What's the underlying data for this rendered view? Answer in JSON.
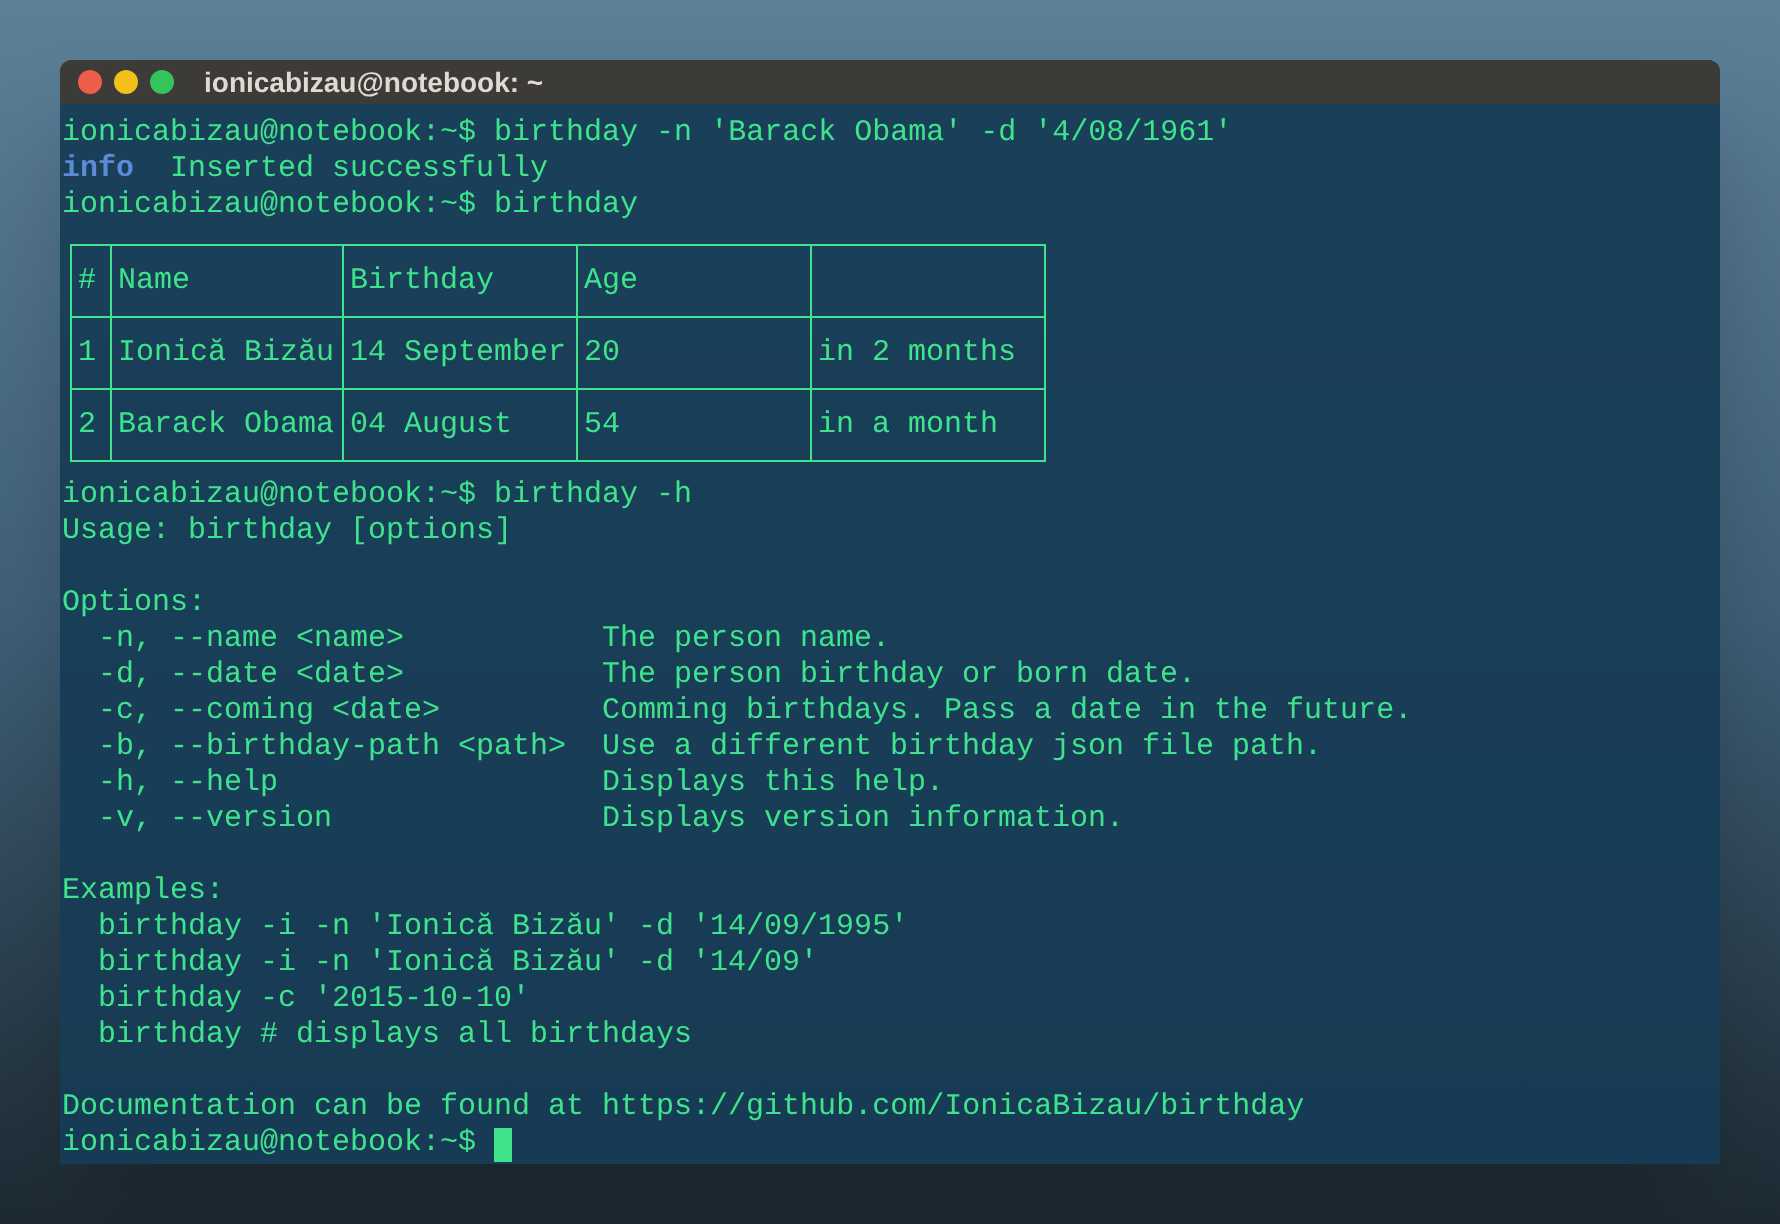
{
  "window": {
    "title": "ionicabizau@notebook: ~"
  },
  "lines": [
    {
      "kind": "command",
      "prompt": "ionicabizau@notebook:~$",
      "command": "birthday -n 'Barack Obama' -d '4/08/1961'"
    },
    {
      "kind": "info",
      "tag": "info",
      "message": "Inserted successfully"
    },
    {
      "kind": "command",
      "prompt": "ionicabizau@notebook:~$",
      "command": "birthday"
    },
    {
      "kind": "table",
      "columns": [
        "#",
        "Name",
        "Birthday",
        "Age"
      ],
      "rows": [
        [
          "1",
          "Ionică Bizău",
          "14 September",
          "20",
          "in 2 months"
        ],
        [
          "2",
          "Barack Obama",
          "04 August",
          "54",
          "in a month"
        ]
      ]
    },
    {
      "kind": "command",
      "prompt": "ionicabizau@notebook:~$",
      "command": "birthday -h"
    },
    {
      "kind": "text",
      "text": "Usage: birthday [options]"
    },
    {
      "kind": "blank"
    },
    {
      "kind": "text",
      "text": "Options:"
    },
    {
      "kind": "option",
      "flag": "-n, --name <name>",
      "description": "The person name."
    },
    {
      "kind": "option",
      "flag": "-d, --date <date>",
      "description": "The person birthday or born date."
    },
    {
      "kind": "option",
      "flag": "-c, --coming <date>",
      "description": "Comming birthdays. Pass a date in the future."
    },
    {
      "kind": "option",
      "flag": "-b, --birthday-path <path>",
      "description": "Use a different birthday json file path."
    },
    {
      "kind": "option",
      "flag": "-h, --help",
      "description": "Displays this help."
    },
    {
      "kind": "option",
      "flag": "-v, --version",
      "description": "Displays version information."
    },
    {
      "kind": "blank"
    },
    {
      "kind": "text",
      "text": "Examples:"
    },
    {
      "kind": "example",
      "text": "birthday -i -n 'Ionică Bizău' -d '14/09/1995'"
    },
    {
      "kind": "example",
      "text": "birthday -i -n 'Ionică Bizău' -d '14/09'"
    },
    {
      "kind": "example",
      "text": "birthday -c '2015-10-10'"
    },
    {
      "kind": "example",
      "text": "birthday # displays all birthdays"
    },
    {
      "kind": "blank"
    },
    {
      "kind": "text",
      "text": "Documentation can be found at https://github.com/IonicaBizau/birthday"
    },
    {
      "kind": "prompt",
      "prompt": "ionicabizau@notebook:~$",
      "cursor": true
    }
  ]
}
